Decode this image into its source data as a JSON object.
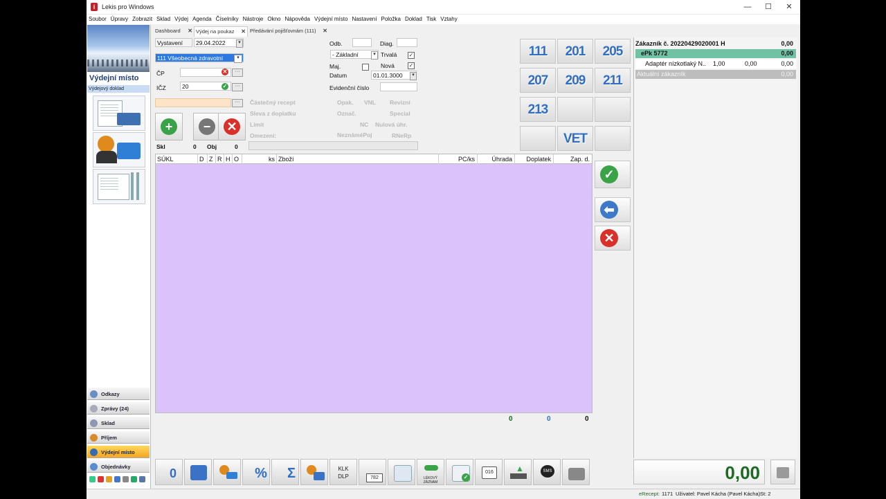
{
  "window": {
    "title": "Lekis pro Windows",
    "min": "—",
    "max": "☐",
    "close": "✕"
  },
  "menu": [
    "Soubor",
    "Úpravy",
    "Zobrazit",
    "Sklad",
    "Výdej",
    "Agenda",
    "Číselníky",
    "Nástroje",
    "Okno",
    "Nápověda",
    "Výdejní místo",
    "Nastavení",
    "Položka",
    "Doklad",
    "Tisk",
    "Vztahy"
  ],
  "left": {
    "title": "Výdejní místo",
    "subtitle": "Výdejový doklad",
    "nav": [
      "Odkazy",
      "Zprávy (24)",
      "Sklad",
      "Příjem",
      "Výdejní místo",
      "Objednávky"
    ]
  },
  "tabs": [
    "Dashboard",
    "Výdej na poukaz",
    "Předávání pojišťovnám (111)"
  ],
  "form": {
    "vystaveni_label": "Vystavení",
    "vystaveni_value": "29.04.2022",
    "pojistovna_value": "111 Všeobecná zdravotní",
    "cp_label": "ČP",
    "icz_label": "IČZ",
    "icz_value": "20",
    "odb_label": "Odb.",
    "diag_label": "Diag.",
    "typ_value": "- Základní",
    "trvala_label": "Trvalá",
    "maj_label": "Maj.",
    "nova_label": "Nová",
    "datum_label": "Datum",
    "datum_value": "01.01.3000",
    "evid_label": "Evidenční číslo",
    "dots": "···",
    "check": "✓"
  },
  "disabled_labels": {
    "castecny": "Částečný recept",
    "opak": "Opak.",
    "vnl": "VNL",
    "revizni": "Revizní",
    "sleva": "Sleva z doplatku",
    "oznac": "Označ.",
    "special": "Special",
    "limit": "Limit",
    "nc": "NC",
    "nulova": "Nulová úhr.",
    "omezeni": "Omezení:",
    "neznamepoj": "NeznáméPoj",
    "rnerp": "RNeRp"
  },
  "skl": {
    "label": "Skl",
    "value": "0",
    "obj_label": "Obj",
    "obj_value": "0"
  },
  "action_buttons": {
    "add": "+",
    "remove": "−",
    "delete": "✕"
  },
  "insurers": [
    "111",
    "201",
    "205",
    "207",
    "209",
    "211",
    "213",
    "",
    "",
    "",
    "VET",
    ""
  ],
  "grid": {
    "columns": [
      "SÚKL",
      "D",
      "Z",
      "R",
      "H",
      "O",
      "ks",
      "Zboží",
      "PC/ks",
      "Úhrada",
      "Doplatek",
      "Zap. d."
    ]
  },
  "totals": [
    "0",
    "0",
    "0"
  ],
  "side_buttons": {
    "ok": "✓",
    "back": "⬅",
    "cancel": "✕"
  },
  "customer": {
    "header": "Zákazník č. 20220429020001 H",
    "header_value": "0,00",
    "epk": "ePk 5772",
    "epk_value": "0,00",
    "item_name": "Adaptér nízkotlaký N..",
    "item_qty": "1,00",
    "item_price": "0,00",
    "item_total": "0,00",
    "current": "Aktuální zákazník",
    "current_value": "0,00"
  },
  "toolbar": {
    "klk": "KLK",
    "dlp": "DLP",
    "sum": "Σ",
    "pct": "%",
    "zero": "0",
    "n782": "782",
    "lek": "LÉKOVÝ ZÁZNAM",
    "n016": "016",
    "sms": "SMS"
  },
  "grand_total": "0,00",
  "status": {
    "erecept_label": "eRecept:",
    "erecept_value": "1171",
    "user": "Uživatel: Pavel Kácha (Pavel Kácha)",
    "st": "St: 2"
  },
  "colors": {
    "grid_bg": "#dcc2fa",
    "accent_green": "#1b6b20",
    "insurer_blue": "#2f6ec4",
    "epk_row": "#6fc3a4"
  }
}
